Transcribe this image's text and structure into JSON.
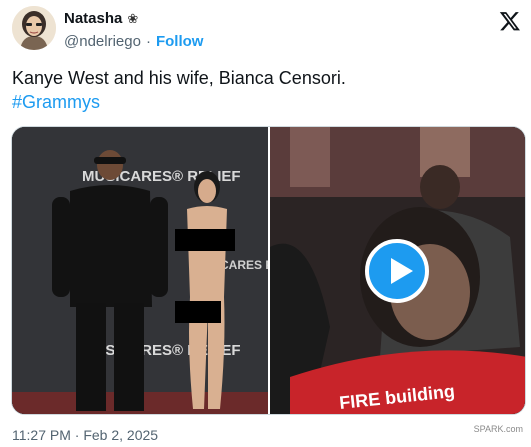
{
  "author": {
    "name": "Natasha",
    "name_emoji": "❀",
    "handle": "@ndelriego",
    "separator": "·",
    "follow_label": "Follow"
  },
  "tweet": {
    "text": "Kanye West and his wife, Bianca Censori.",
    "hashtag": "#Grammys"
  },
  "media": {
    "backdrop_text_top": "MUSICARES® RELIEF",
    "backdrop_text_mid": "MUSICARES FIRE",
    "backdrop_text_bottom": "MUSICARES® RELIEF",
    "banner_text": "FIRE   building",
    "play_icon": "play-icon"
  },
  "footer": {
    "timestamp": "11:27 PM · Feb 2, 2025",
    "watermark_line1": "",
    "watermark_line2": "SPARK.com"
  },
  "colors": {
    "accent": "#1d9bf0",
    "text": "#0f1419",
    "muted": "#536471"
  }
}
